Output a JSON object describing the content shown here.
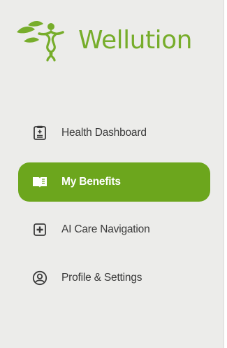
{
  "brand": {
    "name": "Wellution",
    "color": "#77ad2b"
  },
  "nav": {
    "items": [
      {
        "label": "Health Dashboard",
        "icon": "clipboard-document-icon",
        "active": false
      },
      {
        "label": "My Benefits",
        "icon": "open-book-icon",
        "active": true
      },
      {
        "label": "AI Care Navigation",
        "icon": "medical-plus-icon",
        "active": false
      },
      {
        "label": "Profile & Settings",
        "icon": "user-circle-icon",
        "active": false
      }
    ]
  },
  "colors": {
    "sidebar_background": "#ececea",
    "active_background": "#6ca61d",
    "text": "#3a3a3a"
  }
}
